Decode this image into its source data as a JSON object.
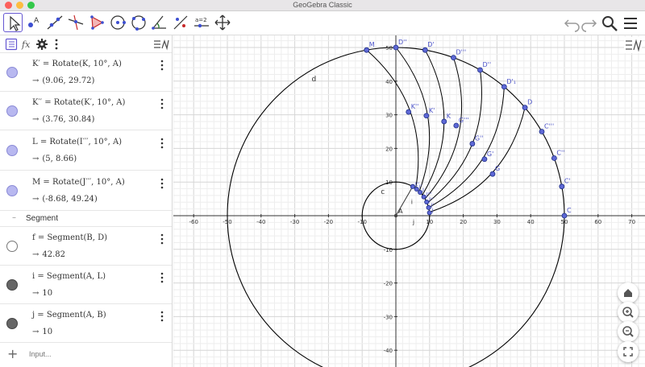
{
  "window": {
    "title": "GeoGebra Classic"
  },
  "toolbar": {
    "tools": [
      "move-tool",
      "point-tool",
      "line-tool",
      "perpendicular-line-tool",
      "polygon-tool",
      "circle-tool",
      "conic-tool",
      "angle-tool",
      "reflect-tool",
      "slider-tool",
      "move-graphics-view-tool"
    ],
    "slider_tool_label": "a=2",
    "right": [
      "undo-icon",
      "redo-icon",
      "search-icon",
      "menu-icon"
    ]
  },
  "algebra": {
    "header": [
      "algebra-view-toggle",
      "fx-input-bar",
      "settings-icon",
      "more-vertical-icon",
      "graphics-style-icon"
    ],
    "entries": [
      {
        "name": "K'",
        "definition": "K′ = Rotate(K, 10°, A)",
        "value": "(9.06, 29.72)",
        "marker": "fill-blue"
      },
      {
        "name": "K''",
        "definition": "K′′ = Rotate(K′, 10°, A)",
        "value": "(3.76, 30.84)",
        "marker": "fill-blue"
      },
      {
        "name": "L",
        "definition": "L = Rotate(I′′′, 10°, A)",
        "value": "(5, 8.66)",
        "marker": "fill-blue"
      },
      {
        "name": "M",
        "definition": "M = Rotate(J′′′, 10°, A)",
        "value": "(-8.68, 49.24)",
        "marker": "fill-blue"
      }
    ],
    "group_label": "Segment",
    "group_toggle": "–",
    "segments": [
      {
        "name": "f",
        "definition": "f = Segment(B, D)",
        "value": "42.82",
        "marker": "empty"
      },
      {
        "name": "i",
        "definition": "i = Segment(A, L)",
        "value": "10",
        "marker": "fill-dark"
      },
      {
        "name": "j",
        "definition": "j = Segment(A, B)",
        "value": "10",
        "marker": "fill-dark"
      }
    ],
    "input_placeholder": "Input...",
    "arrow": "→"
  },
  "graphics": {
    "x_ticks": [
      -60,
      -50,
      -40,
      -30,
      -20,
      -10,
      10,
      20,
      30,
      40,
      50,
      60,
      70
    ],
    "y_ticks": [
      50,
      40,
      30,
      20,
      10,
      -10,
      -20,
      -30,
      -40
    ],
    "origin_label": "A",
    "big_circle": {
      "center": [
        0,
        0
      ],
      "radius": 50,
      "label": "d"
    },
    "small_circle": {
      "center": [
        0,
        0
      ],
      "radius": 10,
      "label": "c"
    },
    "segment_labels": [
      "i",
      "j"
    ],
    "outer_points": [
      {
        "label": "C",
        "angle": 0
      },
      {
        "label": "C'",
        "angle": 10
      },
      {
        "label": "C''",
        "angle": 20
      },
      {
        "label": "C'''",
        "angle": 30
      },
      {
        "label": "D",
        "angle": 40
      },
      {
        "label": "D'₁",
        "angle": 50
      },
      {
        "label": "D''",
        "angle": 60
      },
      {
        "label": "D'''",
        "angle": 70
      },
      {
        "label": "D'",
        "angle": 80
      },
      {
        "label": "D''",
        "angle": 90
      },
      {
        "label": "M",
        "angle": 100
      }
    ],
    "mid_points": [
      {
        "label": "G",
        "x": 28.7,
        "y": 12.4
      },
      {
        "label": "G'",
        "x": 26.3,
        "y": 16.8
      },
      {
        "label": "G''",
        "x": 22.7,
        "y": 21.4
      },
      {
        "label": "G'''",
        "x": 17.9,
        "y": 26.8
      },
      {
        "label": "K",
        "x": 14.3,
        "y": 28.0
      },
      {
        "label": "K'",
        "x": 9.06,
        "y": 29.72
      },
      {
        "label": "K''",
        "x": 3.76,
        "y": 30.84
      }
    ],
    "inner_points": [
      {
        "label": "J",
        "angle": 5
      },
      {
        "label": "J'",
        "angle": 14
      },
      {
        "label": "J''",
        "angle": 24
      },
      {
        "label": "J'''",
        "angle": 34
      },
      {
        "label": "I",
        "angle": 44
      },
      {
        "label": "I'",
        "angle": 52
      },
      {
        "label": "I''",
        "angle": 60
      },
      {
        "label": "L",
        "angle": 60
      }
    ],
    "colors": {
      "point_fill": "#5e68d6",
      "point_stroke": "#1f2f86",
      "label": "#4a52c8",
      "curve": "#000000",
      "grid_minor": "#eeeeee",
      "grid_major": "#d6d6d6"
    }
  },
  "nav": [
    "home-icon",
    "zoom-in-icon",
    "zoom-out-icon",
    "fullscreen-icon"
  ]
}
